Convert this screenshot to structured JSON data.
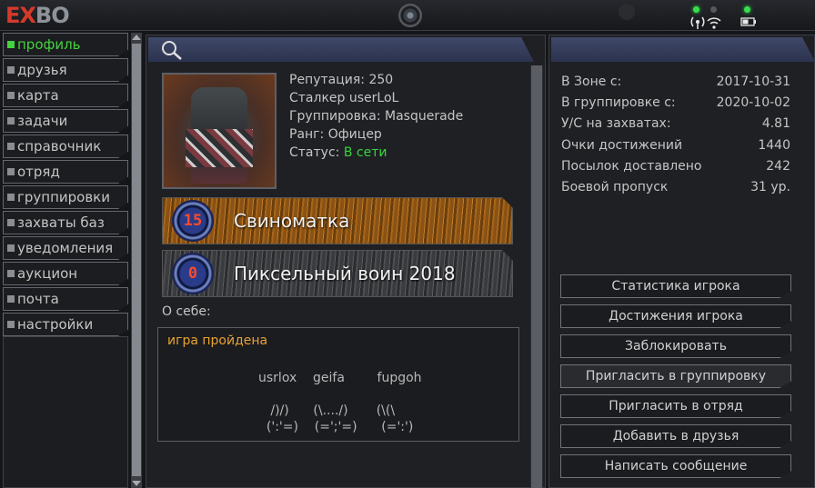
{
  "app": {
    "logo_part1": "EX",
    "logo_part2": "BO"
  },
  "status": {
    "signal_icon": "wifi-icon",
    "battery_icon": "battery-icon"
  },
  "sidebar": {
    "items": [
      {
        "label": "профиль",
        "active": true
      },
      {
        "label": "друзья"
      },
      {
        "label": "карта"
      },
      {
        "label": "задачи"
      },
      {
        "label": "справочник"
      },
      {
        "label": "отряд"
      },
      {
        "label": "группировки"
      },
      {
        "label": "захваты баз"
      },
      {
        "label": "уведомления"
      },
      {
        "label": "аукцион"
      },
      {
        "label": "почта"
      },
      {
        "label": "настройки"
      }
    ]
  },
  "profile": {
    "reputation": "Репутация: 250",
    "name": "Сталкер userLoL",
    "faction": "Группировка: Masquerade",
    "rank": "Ранг: Офицер",
    "status_label": "Статус: ",
    "status_value": "В сети",
    "achievements": [
      {
        "badge": "15",
        "title": "Свиноматка"
      },
      {
        "badge": "0",
        "title": "Пиксельный воин 2018"
      }
    ],
    "about_label": "О себе:",
    "about_first": "игра пройдена",
    "about_art": "usrlox    geifa        fupgoh\n\n   /)/)      (\\..../)       (\\(\\\n  (':'=)    (=';'=)      (=':')"
  },
  "stats": [
    {
      "label": "В Зоне с:",
      "value": "2017-10-31"
    },
    {
      "label": "В группировке с:",
      "value": "2020-10-02"
    },
    {
      "label": "У/С на захватах:",
      "value": "4.81"
    },
    {
      "label": "Очки достижений",
      "value": "1440"
    },
    {
      "label": "Посылок доставлено",
      "value": "242"
    },
    {
      "label": "Боевой пропуск",
      "value": "31 ур."
    }
  ],
  "actions": [
    "Статистика игрока",
    "Достижения игрока",
    "Заблокировать",
    "Пригласить в группировку",
    "Пригласить в отряд",
    "Добавить в друзья",
    "Написать сообщение"
  ],
  "colors": {
    "accent_green": "#44d23e",
    "online": "#38d43a",
    "about_highlight": "#e8a232",
    "header": "#3f4868"
  }
}
